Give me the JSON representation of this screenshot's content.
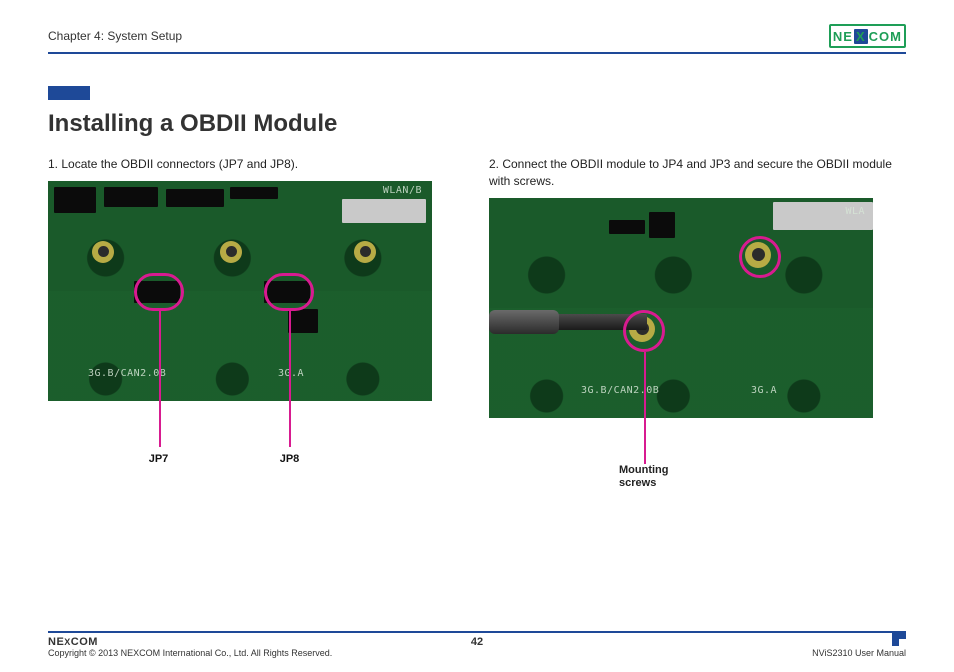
{
  "header": {
    "chapter": "Chapter 4: System Setup",
    "brand_left": "NE",
    "brand_x": "X",
    "brand_right": "COM"
  },
  "title": "Installing a OBDII Module",
  "steps": {
    "s1": "1. Locate the OBDII connectors (JP7 and JP8).",
    "s2": "2. Connect the OBDII module to JP4 and JP3 and secure the OBDII module with screws."
  },
  "callouts": {
    "left1": "JP7",
    "left2": "JP8",
    "right1": "Mounting",
    "right2": "screws"
  },
  "silkscreen": {
    "label_a": "3G.B/CAN2.0B",
    "label_b": "3G.A",
    "label_wlan_right": "WLA",
    "label_wlan_left": "WLAN/B"
  },
  "footer": {
    "copyright": "Copyright © 2013 NEXCOM International Co., Ltd. All Rights Reserved.",
    "page": "42",
    "doc": "NViS2310 User Manual",
    "brand_left": "NE",
    "brand_x": "X",
    "brand_right": "COM"
  }
}
